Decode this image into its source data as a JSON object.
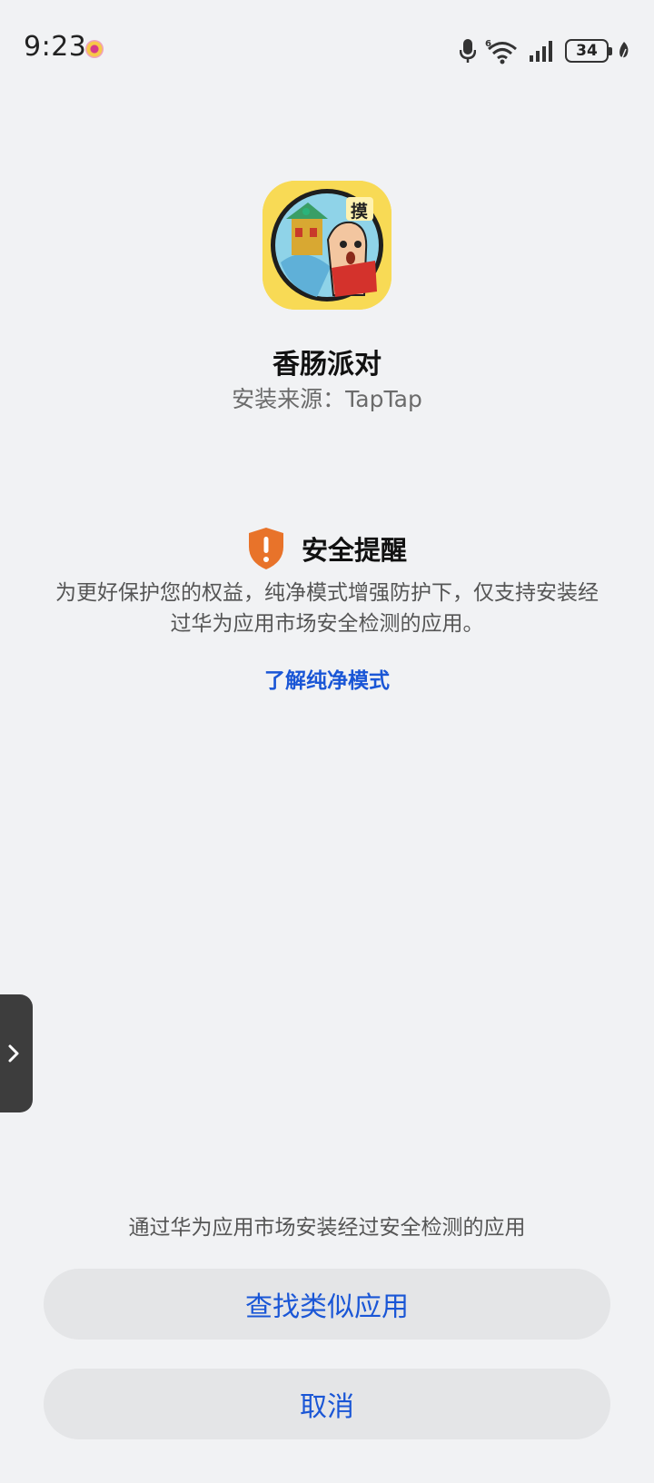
{
  "status_bar": {
    "time": "9:23",
    "battery": "34"
  },
  "app": {
    "name": "香肠派对",
    "source_line": "安装来源：TapTap",
    "icon_badge": "摸"
  },
  "security": {
    "title": "安全提醒",
    "description": "为更好保护您的权益，纯净模式增强防护下，仅支持安装经过华为应用市场安全检测的应用。",
    "learn_more": "了解纯净模式"
  },
  "footer": {
    "hint": "通过华为应用市场安装经过安全检测的应用",
    "find_similar": "查找类似应用",
    "cancel": "取消"
  },
  "colors": {
    "accent": "#1a56d6",
    "warning": "#e8732a",
    "background": "#f1f2f4",
    "button_bg": "#e4e5e7"
  }
}
